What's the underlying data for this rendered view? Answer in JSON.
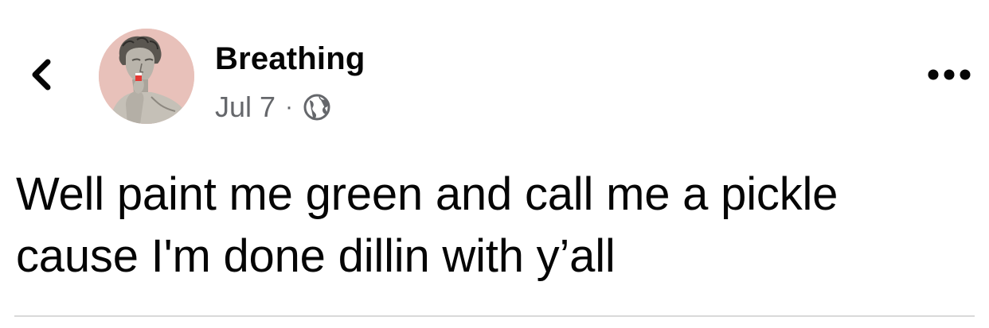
{
  "post": {
    "author_name": "Breathing",
    "date": "Jul 7",
    "separator": "·",
    "audience_icon": "globe-icon",
    "text_lines": [
      "Well paint me green and call me a pickle",
      "cause I'm done dillin with y’all"
    ]
  },
  "header": {
    "back_icon": "chevron-left-icon",
    "more_icon": "more-horizontal-icon"
  },
  "colors": {
    "avatar_background": "#e8c1ba",
    "text_primary": "#050505",
    "text_secondary": "#65676b",
    "divider": "#d9d9d9"
  }
}
